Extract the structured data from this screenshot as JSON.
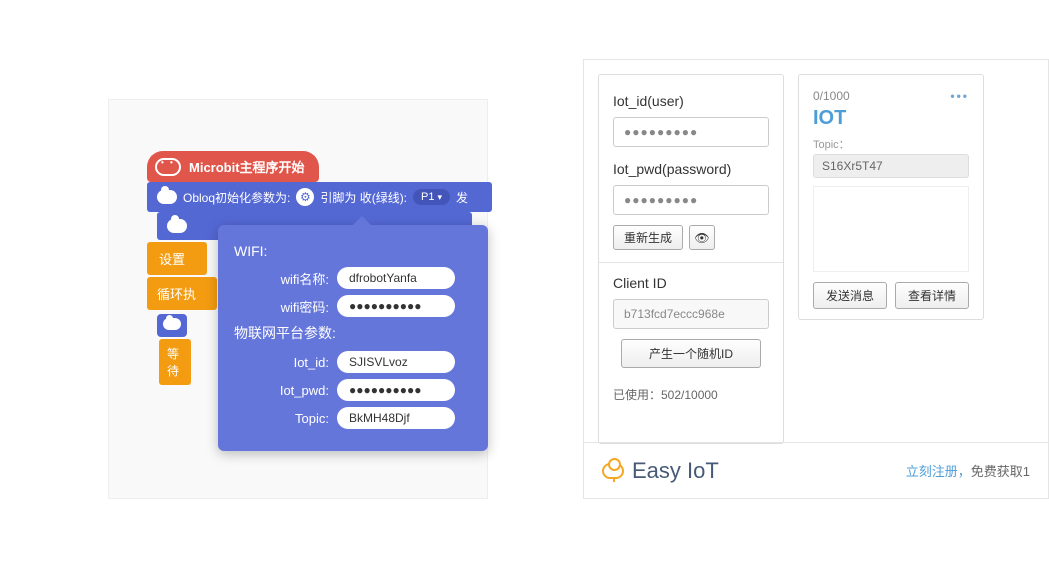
{
  "blocks": {
    "hat_label": "Microbit主程序开始",
    "obloq_init": "Obloq初始化参数为:",
    "pin_label_rx": "引脚为 收(绿线):",
    "pin_rx": "P1",
    "tx_prefix": "发",
    "set_label": "设置",
    "loop_label": "循环执",
    "wait_label": "等待"
  },
  "config": {
    "wifi_title": "WIFI:",
    "wifi_name_label": "wifi名称:",
    "wifi_name": "dfrobotYanfa",
    "wifi_pwd_label": "wifi密码:",
    "wifi_pwd": "●●●●●●●●●●",
    "iot_title": "物联网平台参数:",
    "iot_id_label": "Iot_id:",
    "iot_id": "SJISVLvoz",
    "iot_pwd_label": "Iot_pwd:",
    "iot_pwd": "●●●●●●●●●●",
    "topic_label": "Topic:",
    "topic": "BkMH48Djf"
  },
  "iot_panel": {
    "iot_id_label": "Iot_id(user)",
    "iot_id_value": "●●●●●●●●●",
    "iot_pwd_label": "Iot_pwd(password)",
    "iot_pwd_value": "●●●●●●●●●",
    "regen_btn": "重新生成",
    "client_id_label": "Client ID",
    "client_id_value": "b713fcd7eccc968e",
    "random_id_btn": "产生一个随机ID",
    "usage": "已使用：502/10000",
    "count": "0/1000",
    "device_title": "IOT",
    "topic_label": "Topic：",
    "topic_value": "S16Xr5T47",
    "send_msg_btn": "发送消息",
    "view_detail_btn": "查看详情"
  },
  "footer": {
    "brand": "Easy IoT",
    "register_link": "立刻注册，",
    "register_tail": "免费获取1"
  }
}
